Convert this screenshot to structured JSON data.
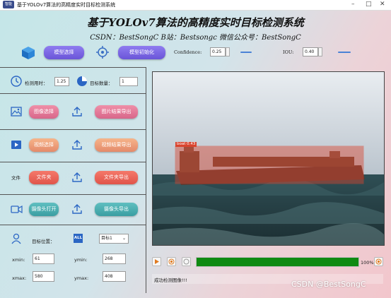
{
  "window": {
    "title": "基于YOLOv7算法的高精度实时目标检测系统",
    "icon_text": "智能"
  },
  "header": {
    "title": "基于YOLOv7算法的高精度实时目标检测系统",
    "subtitle": "CSDN：BestSongC   B站：Bestsongc   微信公众号：BestSongC"
  },
  "toolbar": {
    "model_select_label": "模型选择",
    "model_init_label": "模型初始化",
    "confidence_label": "Confidence:",
    "confidence_value": "0.25",
    "iou_label": "IOU:",
    "iou_value": "0.40"
  },
  "stats": {
    "time_label": "检测用时：",
    "time_value": "1.25",
    "count_label": "目标数量：",
    "count_value": "1"
  },
  "image_row": {
    "select_label": "图像选择",
    "export_label": "图片结果导出"
  },
  "video_row": {
    "select_label": "视频选择",
    "export_label": "视频结果导出"
  },
  "folder_row": {
    "icon_text": "文件",
    "select_label": "文件夹",
    "export_label": "文件夹导出"
  },
  "camera_row": {
    "select_label": "摄像头打开",
    "export_label": "摄像头导出"
  },
  "target": {
    "position_label": "目标位置：",
    "all_badge": "ALL",
    "select_value": "目标1",
    "xmin_label": "xmin:",
    "xmin_value": "61",
    "ymin_label": "ymin:",
    "ymin_value": "268",
    "xmax_label": "xmax:",
    "xmax_value": "580",
    "ymax_label": "ymax:",
    "ymax_value": "408"
  },
  "viewer": {
    "detection_label": "boat 0.43"
  },
  "playback": {
    "progress_percent": 100,
    "progress_text": "100%"
  },
  "status": {
    "message": "成功检测图像!!!"
  },
  "watermark": "CSDN @BestSongC",
  "colors": {
    "accent_purple": "#7a66e0",
    "progress_green": "#0f8a12",
    "box_red": "#d9442e"
  }
}
